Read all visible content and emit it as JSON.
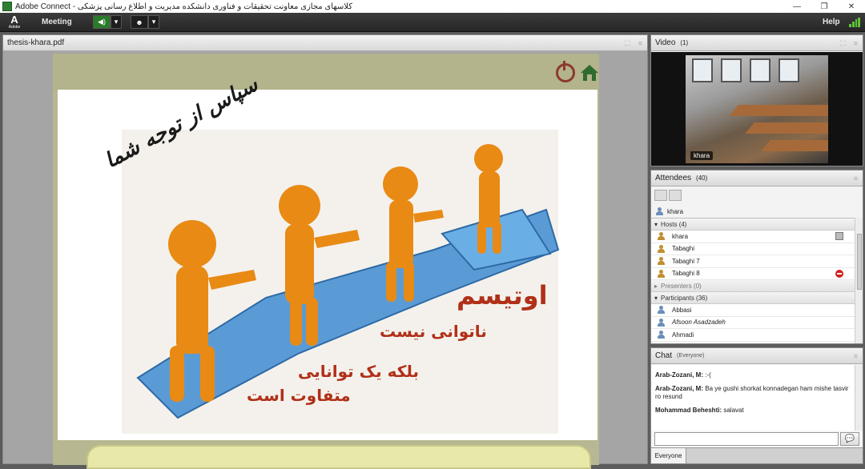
{
  "window": {
    "title": "کلاسهای مجازی معاونت تحقیقات و فناوری دانشکده مدیریت و اطلاع رسانی پزشکی - Adobe Connect",
    "controls": [
      "—",
      "❐",
      "✕"
    ]
  },
  "menubar": {
    "logo_text": "Adobe",
    "meeting_label": "Meeting",
    "help_label": "Help"
  },
  "share_pod": {
    "title": "thesis-khara.pdf",
    "slide": {
      "thanks": "سپاس از توجه شما",
      "autism": "اوتیسم",
      "line1": "ناتوانی نیست",
      "line2": "بلکه یک توانایی",
      "line3": "متفاوت است"
    }
  },
  "video_pod": {
    "title": "Video",
    "count": "(1)",
    "name_tag": "khara"
  },
  "attendees_pod": {
    "title": "Attendees",
    "count": "(40)",
    "me": "khara",
    "hosts_label": "Hosts (4)",
    "hosts": [
      "khara",
      "Tabaghi",
      "Tabaghi 7",
      "Tabaghi 8"
    ],
    "presenters_label": "Presenters (0)",
    "participants_label": "Participants (36)",
    "participants": [
      "Abbasi",
      "Afsoon Asadzadeh",
      "Ahmadi"
    ]
  },
  "chat_pod": {
    "title": "Chat",
    "scope": "(Everyone)",
    "messages": [
      {
        "author": "Arab-Zozani, M:",
        "text": ":-("
      },
      {
        "author": "Arab-Zozani, M:",
        "text": "Ba ye gushi shorkat konnadegan ham mishe tasvir ro resund"
      },
      {
        "author": "Mohammad Beheshti:",
        "text": "salavat"
      }
    ],
    "tab_everyone": "Everyone"
  },
  "colors": {
    "accent_green": "#5ec639",
    "slide_text_red": "#b03018",
    "no_entry_red": "#d42020"
  }
}
